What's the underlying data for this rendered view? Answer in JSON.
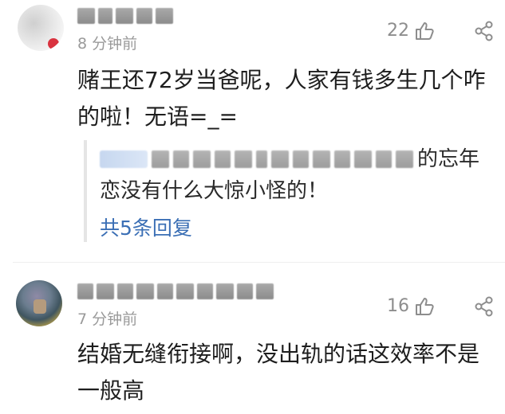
{
  "comments": [
    {
      "time": "8 分钟前",
      "likes": "22",
      "text_lines": [
        "赌王还72岁当爸呢，人家有钱多生几个咋",
        "的啦！无语=_="
      ],
      "reply": {
        "line1_tail": "的忘年",
        "line2": "恋没有什么大惊小怪的！",
        "more_label": "共5条回复"
      }
    },
    {
      "time": "7 分钟前",
      "likes": "16",
      "text_lines": [
        "结婚无缝衔接啊，没出轨的话这效率不是",
        "一般高"
      ]
    }
  ],
  "icons": {
    "like": "thumbs-up-icon",
    "share": "share-icon"
  },
  "colors": {
    "link": "#3b6fb5",
    "meta": "#9a9a9a",
    "avatar_badge": "#d9333f"
  }
}
